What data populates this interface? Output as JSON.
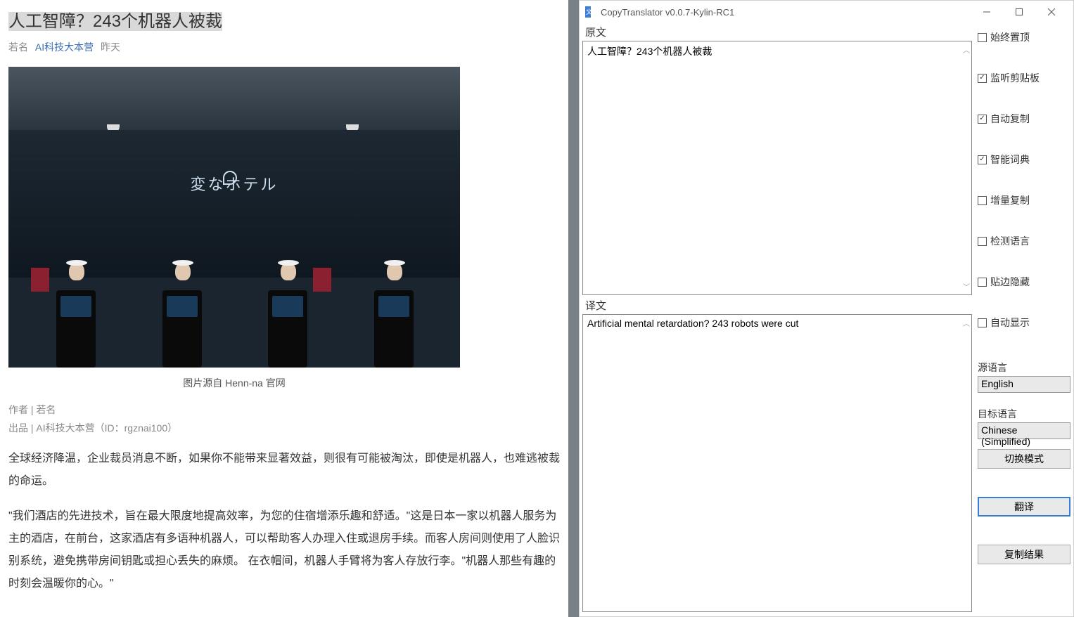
{
  "article": {
    "title": "人工智障？243个机器人被裁",
    "meta_author": "若名",
    "meta_source": "AI科技大本营",
    "meta_time": "昨天",
    "image_logo": "変なホテル",
    "caption": "图片源自 Henn-na 官网",
    "byline_author": "作者 | 若名",
    "byline_publisher": "出品 | AI科技大本营（ID：rgznai100）",
    "para1": "全球经济降温，企业裁员消息不断，如果你不能带来显著效益，则很有可能被淘汰，即使是机器人，也难逃被裁的命运。",
    "para2": "\"我们酒店的先进技术，旨在最大限度地提高效率，为您的住宿增添乐趣和舒适。\"这是日本一家以机器人服务为主的酒店，在前台，这家酒店有多语种机器人，可以帮助客人办理入住或退房手续。而客人房间则使用了人脸识别系统，避免携带房间钥匙或担心丢失的麻烦。 在衣帽间，机器人手臂将为客人存放行李。\"机器人那些有趣的时刻会温暖你的心。\""
  },
  "app": {
    "title": "CopyTranslator v0.0.7-Kylin-RC1",
    "source_label": "原文",
    "target_label": "译文",
    "source_text": "人工智障？243个机器人被裁",
    "target_text": "Artificial mental retardation? 243 robots were cut",
    "checks": {
      "always_top": "始终置顶",
      "listen_clip": "监听剪贴板",
      "auto_copy": "自动复制",
      "smart_dict": "智能词典",
      "inc_copy": "增量复制",
      "detect_lang": "检测语言",
      "hide_edge": "贴边隐藏",
      "auto_show": "自动显示"
    },
    "lang_src_label": "源语言",
    "lang_src_value": "English",
    "lang_tgt_label": "目标语言",
    "lang_tgt_value": "Chinese (Simplified)",
    "btn_switch": "切换模式",
    "btn_translate": "翻译",
    "btn_copy": "复制结果"
  }
}
